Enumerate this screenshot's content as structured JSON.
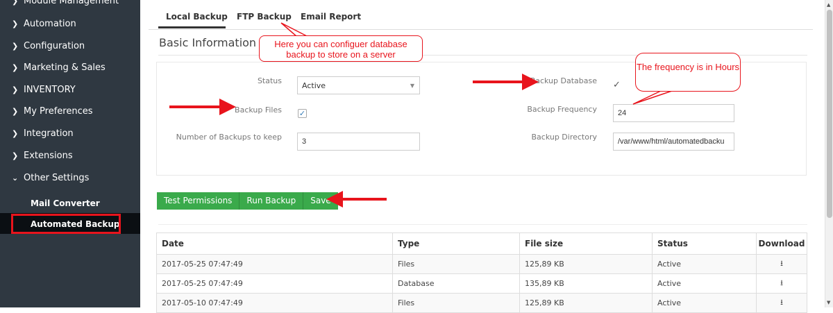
{
  "sidebar": {
    "items": [
      {
        "label": "Module Management",
        "icon": "chevron-right-icon"
      },
      {
        "label": "Automation",
        "icon": "chevron-right-icon"
      },
      {
        "label": "Configuration",
        "icon": "chevron-right-icon"
      },
      {
        "label": "Marketing & Sales",
        "icon": "chevron-right-icon"
      },
      {
        "label": "INVENTORY",
        "icon": "chevron-right-icon"
      },
      {
        "label": "My Preferences",
        "icon": "chevron-right-icon"
      },
      {
        "label": "Integration",
        "icon": "chevron-right-icon"
      },
      {
        "label": "Extensions",
        "icon": "chevron-right-icon"
      },
      {
        "label": "Other Settings",
        "icon": "chevron-down-icon"
      }
    ],
    "sub_items": [
      {
        "label": "Mail Converter"
      },
      {
        "label": "Automated Backup",
        "active": true
      }
    ]
  },
  "tabs": [
    {
      "label": "Local Backup",
      "active": true
    },
    {
      "label": "FTP Backup"
    },
    {
      "label": "Email Report"
    }
  ],
  "section_title": "Basic Information",
  "form": {
    "status_label": "Status",
    "status_value": "Active",
    "backup_files_label": "Backup Files",
    "backup_files_checked": true,
    "num_backups_label": "Number of Backups to keep",
    "num_backups_value": "3",
    "backup_db_label": "Backup Database",
    "backup_db_checked": true,
    "backup_freq_label": "Backup Frequency",
    "backup_freq_value": "24",
    "backup_dir_label": "Backup Directory",
    "backup_dir_value": "/var/www/html/automatedbacku"
  },
  "buttons": {
    "test_permissions": "Test Permissions",
    "run_backup": "Run Backup",
    "save": "Save"
  },
  "table": {
    "headers": [
      "Date",
      "Type",
      "File size",
      "Status",
      "Download"
    ],
    "rows": [
      {
        "date": "2017-05-25 07:47:49",
        "type": "Files",
        "size": "125,89 KB",
        "status": "Active"
      },
      {
        "date": "2017-05-25 07:47:49",
        "type": "Database",
        "size": "135,89 KB",
        "status": "Active"
      },
      {
        "date": "2017-05-10 07:47:49",
        "type": "Files",
        "size": "125,89 KB",
        "status": "Active"
      }
    ]
  },
  "callouts": {
    "ftp": "Here you can configuer database backup to store on a server",
    "frequency": "The frequency is in Hours"
  },
  "colors": {
    "sidebar_bg": "#2f3841",
    "button_green": "#3aaa4b",
    "annotation_red": "#e8141c"
  }
}
